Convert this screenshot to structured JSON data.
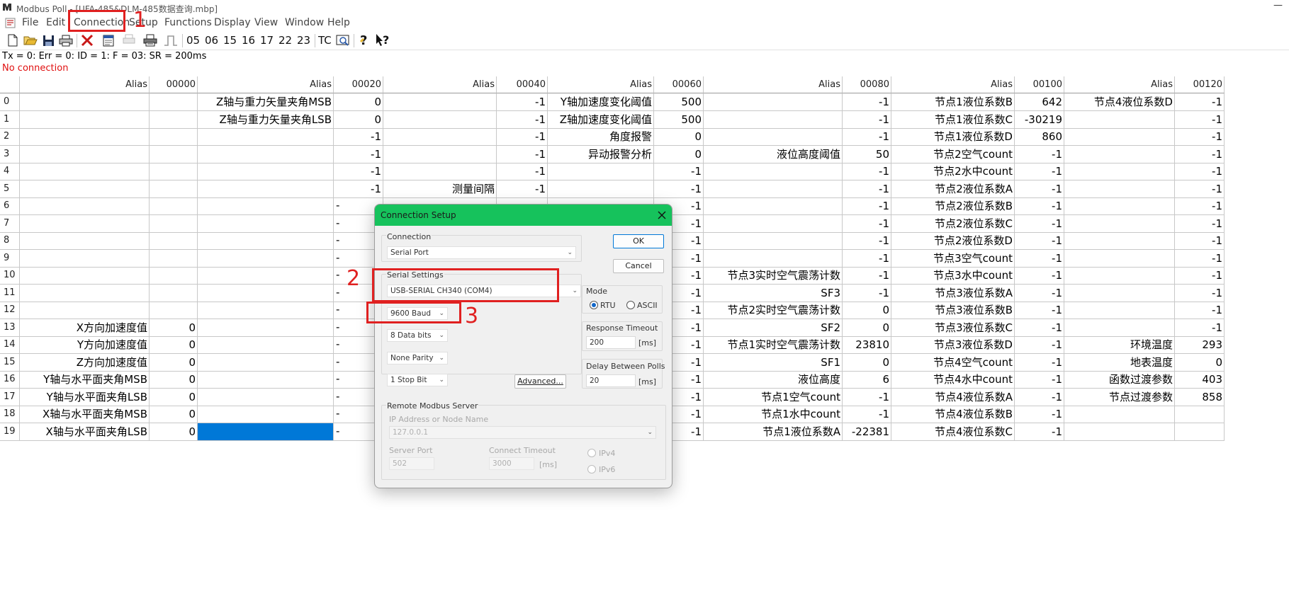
{
  "window": {
    "title": "Modbus Poll - [UFA-485&DLM-485数据查询.mbp]",
    "minimize_glyph": "—"
  },
  "menu": {
    "file": "File",
    "edit": "Edit",
    "connection": "Connection",
    "setup": "Setup",
    "functions": "Functions",
    "display": "Display",
    "view": "View",
    "window": "Window",
    "help": "Help"
  },
  "toolbar": {
    "icons": [
      "new-icon",
      "open-icon",
      "save-icon",
      "print-icon",
      "delete-icon",
      "window-icon",
      "disabled-print-icon",
      "printer-icon",
      "pulse-icon"
    ],
    "codes": [
      "05",
      "06",
      "15",
      "16",
      "17",
      "22",
      "23",
      "TC"
    ],
    "tail_icons": [
      "monitor-icon",
      "help-icon",
      "whats-this-icon"
    ]
  },
  "status": {
    "line1": "Tx = 0: Err = 0: ID = 1: F = 03: SR = 200ms",
    "line2": "No connection"
  },
  "grid": {
    "headers": [
      "",
      "Alias",
      "00000",
      "Alias",
      "00020",
      "Alias",
      "00040",
      "Alias",
      "00060",
      "Alias",
      "00080",
      "Alias",
      "00100",
      "Alias",
      "00120"
    ],
    "rows": [
      [
        "0",
        "",
        "",
        "Z轴与重力矢量夹角MSB",
        "0",
        "",
        "-1",
        "Y轴加速度变化阈值",
        "500",
        "",
        "-1",
        "节点1液位系数B",
        "642",
        "节点4液位系数D",
        "-1"
      ],
      [
        "1",
        "",
        "",
        "Z轴与重力矢量夹角LSB",
        "0",
        "",
        "-1",
        "Z轴加速度变化阈值",
        "500",
        "",
        "-1",
        "节点1液位系数C",
        "-30219",
        "",
        "-1"
      ],
      [
        "2",
        "",
        "",
        "",
        "-1",
        "",
        "-1",
        "角度报警",
        "0",
        "",
        "-1",
        "节点1液位系数D",
        "860",
        "",
        "-1"
      ],
      [
        "3",
        "",
        "",
        "",
        "-1",
        "",
        "-1",
        "异动报警分析",
        "0",
        "液位高度阈值",
        "50",
        "节点2空气count",
        "-1",
        "",
        "-1"
      ],
      [
        "4",
        "",
        "",
        "",
        "-1",
        "",
        "-1",
        "",
        "-1",
        "",
        "-1",
        "节点2水中count",
        "-1",
        "",
        "-1"
      ],
      [
        "5",
        "",
        "",
        "",
        "-1",
        "测量间隔",
        "-1",
        "",
        "-1",
        "",
        "-1",
        "节点2液位系数A",
        "-1",
        "",
        "-1"
      ],
      [
        "6",
        "",
        "",
        "",
        "",
        "",
        "",
        "",
        "-1",
        "",
        "-1",
        "节点2液位系数B",
        "-1",
        "",
        "-1"
      ],
      [
        "7",
        "",
        "",
        "",
        "",
        "",
        "",
        "",
        "-1",
        "",
        "-1",
        "节点2液位系数C",
        "-1",
        "",
        "-1"
      ],
      [
        "8",
        "",
        "",
        "",
        "",
        "",
        "",
        "",
        "-1",
        "",
        "-1",
        "节点2液位系数D",
        "-1",
        "",
        "-1"
      ],
      [
        "9",
        "",
        "",
        "",
        "",
        "",
        "",
        "",
        "-1",
        "",
        "-1",
        "节点3空气count",
        "-1",
        "",
        "-1"
      ],
      [
        "10",
        "",
        "",
        "",
        "",
        "",
        "",
        "",
        "-1",
        "节点3实时空气震荡计数",
        "-1",
        "节点3水中count",
        "-1",
        "",
        "-1"
      ],
      [
        "11",
        "",
        "",
        "",
        "",
        "",
        "",
        "",
        "-1",
        "SF3",
        "-1",
        "节点3液位系数A",
        "-1",
        "",
        "-1"
      ],
      [
        "12",
        "",
        "",
        "",
        "",
        "",
        "",
        "",
        "-1",
        "节点2实时空气震荡计数",
        "0",
        "节点3液位系数B",
        "-1",
        "",
        "-1"
      ],
      [
        "13",
        "X方向加速度值",
        "0",
        "",
        "",
        "",
        "",
        "",
        "-1",
        "SF2",
        "0",
        "节点3液位系数C",
        "-1",
        "",
        "-1"
      ],
      [
        "14",
        "Y方向加速度值",
        "0",
        "",
        "",
        "",
        "",
        "",
        "-1",
        "节点1实时空气震荡计数",
        "23810",
        "节点3液位系数D",
        "-1",
        "环境温度",
        "293"
      ],
      [
        "15",
        "Z方向加速度值",
        "0",
        "",
        "",
        "",
        "",
        "",
        "-1",
        "SF1",
        "0",
        "节点4空气count",
        "-1",
        "地表温度",
        "0"
      ],
      [
        "16",
        "Y轴与水平面夹角MSB",
        "0",
        "",
        "",
        "",
        "",
        "",
        "-1",
        "液位高度",
        "6",
        "节点4水中count",
        "-1",
        "函数过渡参数",
        "403"
      ],
      [
        "17",
        "Y轴与水平面夹角LSB",
        "0",
        "",
        "",
        "",
        "",
        "",
        "-1",
        "节点1空气count",
        "-1",
        "节点4液位系数A",
        "-1",
        "节点过渡参数",
        "858"
      ],
      [
        "18",
        "X轴与水平面夹角MSB",
        "0",
        "",
        "",
        "",
        "",
        "",
        "-1",
        "节点1水中count",
        "-1",
        "节点4液位系数B",
        "-1",
        "",
        ""
      ],
      [
        "19",
        "X轴与水平面夹角LSB",
        "0",
        "",
        "",
        "",
        "",
        "",
        "-1",
        "节点1液位系数A",
        "-22381",
        "节点4液位系数C",
        "-1",
        "",
        ""
      ]
    ],
    "hidden_dash": "-"
  },
  "dialog": {
    "title": "Connection Setup",
    "connection_label": "Connection",
    "connection_value": "Serial Port",
    "serial_settings_label": "Serial Settings",
    "port_value": "USB-SERIAL CH340 (COM4)",
    "baud_value": "9600 Baud",
    "data_bits_value": "8 Data bits",
    "parity_value": "None Parity",
    "stop_bit_value": "1 Stop Bit",
    "advanced_button": "Advanced...",
    "ok_button": "OK",
    "cancel_button": "Cancel",
    "mode_label": "Mode",
    "mode_rtu": "RTU",
    "mode_ascii": "ASCII",
    "response_timeout_label": "Response Timeout",
    "response_timeout_value": "200",
    "response_timeout_unit": "[ms]",
    "delay_label": "Delay Between Polls",
    "delay_value": "20",
    "delay_unit": "[ms]",
    "remote_label": "Remote Modbus Server",
    "ip_label": "IP Address or Node Name",
    "ip_value": "127.0.0.1",
    "server_port_label": "Server Port",
    "server_port_value": "502",
    "connect_timeout_label": "Connect Timeout",
    "connect_timeout_value": "3000",
    "connect_timeout_unit": "[ms]",
    "ipv4": "IPv4",
    "ipv6": "IPv6"
  },
  "annotations": {
    "step1": "1",
    "step2": "2",
    "step3": "3",
    "color": "#e02020"
  }
}
